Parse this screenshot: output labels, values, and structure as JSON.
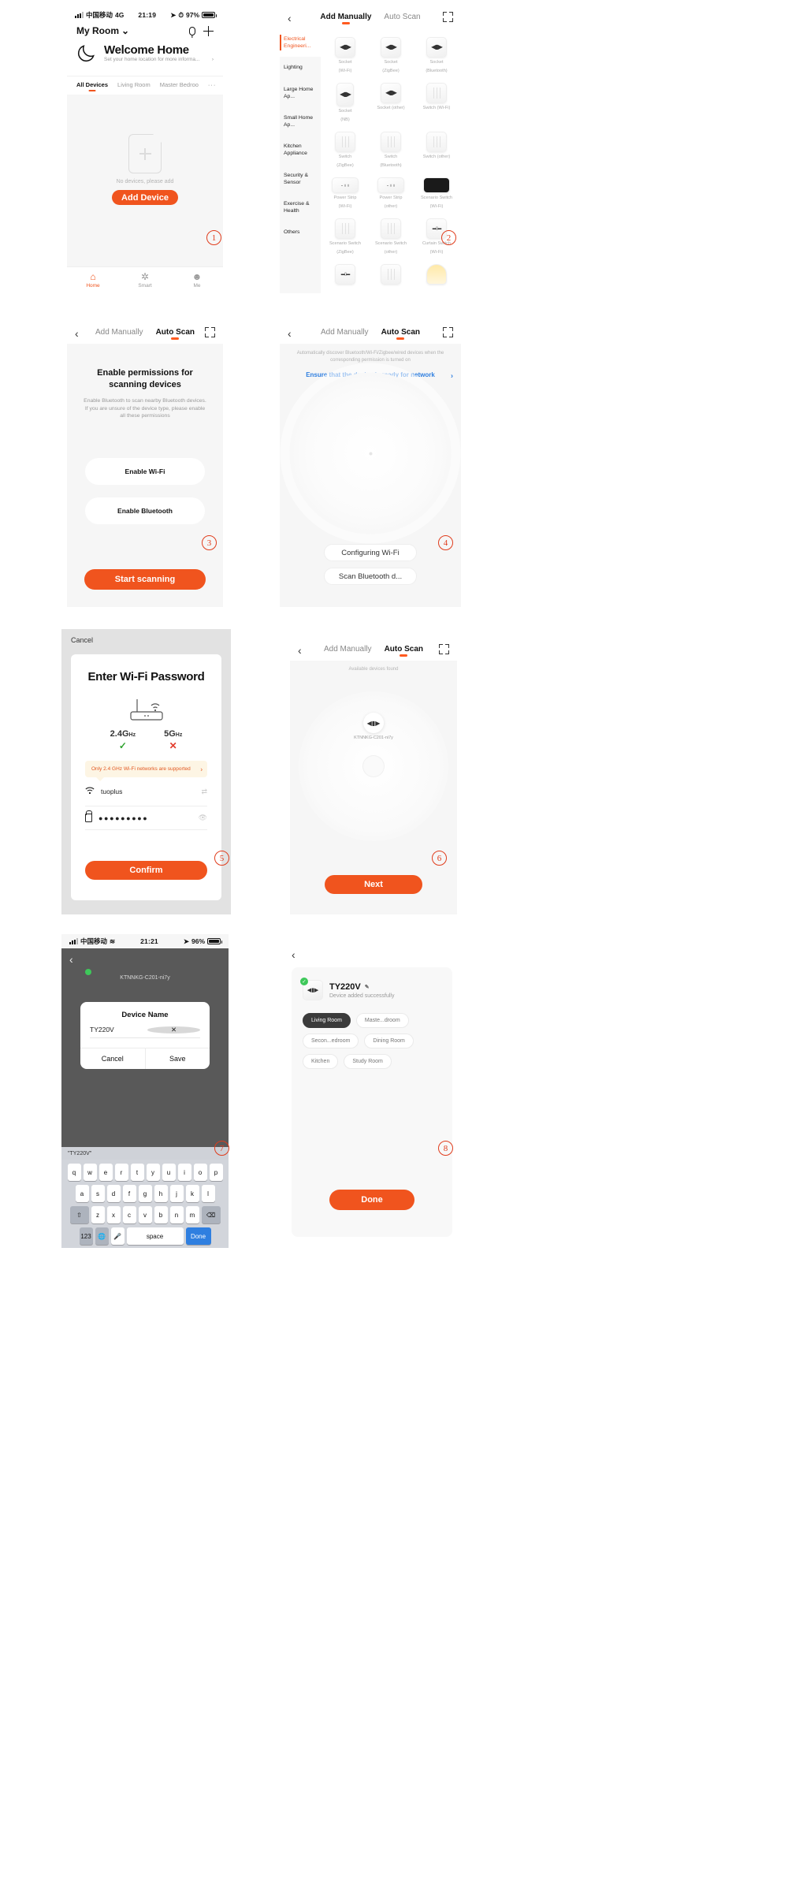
{
  "panel1": {
    "status": {
      "carrier": "中国移动",
      "network": "4G",
      "time": "21:19",
      "battery": "97%"
    },
    "room_name": "My Room",
    "icons": {
      "mic": "mic-icon",
      "add": "plus-icon",
      "chevron": "⌄"
    },
    "welcome_title": "Welcome Home",
    "welcome_sub": "Set your home location for more informa...",
    "tabs": [
      {
        "label": "All Devices",
        "active": true
      },
      {
        "label": "Living Room",
        "active": false
      },
      {
        "label": "Master Bedroo",
        "active": false
      }
    ],
    "more": "···",
    "empty_text": "No devices, please add",
    "add_device": "Add Device",
    "bottom_nav": [
      {
        "label": "Home",
        "icon": "home-icon",
        "glyph": "⌂",
        "active": true
      },
      {
        "label": "Smart",
        "icon": "smart-icon",
        "glyph": "✲",
        "active": false
      },
      {
        "label": "Me",
        "icon": "profile-icon",
        "glyph": "☻",
        "active": false
      }
    ],
    "badge": "1"
  },
  "panel2": {
    "nav": {
      "back": "‹",
      "tabs": [
        {
          "label": "Add Manually",
          "active": true
        },
        {
          "label": "Auto Scan",
          "active": false
        }
      ],
      "scan": "scan-icon"
    },
    "categories": [
      {
        "label": "Electrical Engineeri...",
        "active": true
      },
      {
        "label": "Lighting",
        "active": false
      },
      {
        "label": "Large Home Ap...",
        "active": false
      },
      {
        "label": "Small Home Ap...",
        "active": false
      },
      {
        "label": "Kitchen Appliance",
        "active": false
      },
      {
        "label": "Security & Sensor",
        "active": false
      },
      {
        "label": "Exercise & Health",
        "active": false
      },
      {
        "label": "Others",
        "active": false
      }
    ],
    "devices": [
      {
        "l1": "Socket",
        "l2": "(Wi-Fi)",
        "kind": "socket"
      },
      {
        "l1": "Socket",
        "l2": "(ZigBee)",
        "kind": "socket"
      },
      {
        "l1": "Socket",
        "l2": "(Bluetooth)",
        "kind": "socket"
      },
      {
        "l1": "Socket",
        "l2": "(NB)",
        "kind": "socket-tall"
      },
      {
        "l1": "Socket (other)",
        "l2": "",
        "kind": "socket"
      },
      {
        "l1": "Switch (Wi-Fi)",
        "l2": "",
        "kind": "switch"
      },
      {
        "l1": "Switch",
        "l2": "(ZigBee)",
        "kind": "switch"
      },
      {
        "l1": "Switch",
        "l2": "(Bluetooth)",
        "kind": "switch"
      },
      {
        "l1": "Switch (other)",
        "l2": "",
        "kind": "switch"
      },
      {
        "l1": "Power Strip",
        "l2": "(Wi-Fi)",
        "kind": "strip"
      },
      {
        "l1": "Power Strip",
        "l2": "(other)",
        "kind": "strip"
      },
      {
        "l1": "Scenario Switch",
        "l2": "(Wi-Fi)",
        "kind": "black"
      },
      {
        "l1": "Scenario Switch",
        "l2": "(ZigBee)",
        "kind": "plain"
      },
      {
        "l1": "Scenario Switch",
        "l2": "(other)",
        "kind": "plain"
      },
      {
        "l1": "Curtain Switch",
        "l2": "(Wi-Fi)",
        "kind": "curtain"
      },
      {
        "l1": "",
        "l2": "",
        "kind": "curtain"
      },
      {
        "l1": "",
        "l2": "",
        "kind": "switch"
      },
      {
        "l1": "",
        "l2": "",
        "kind": "lamp"
      }
    ],
    "badge": "2"
  },
  "panel3": {
    "nav": {
      "back": "‹",
      "tabs": [
        {
          "label": "Add Manually",
          "active": false
        },
        {
          "label": "Auto Scan",
          "active": true
        }
      ],
      "scan": "scan-icon"
    },
    "title": "Enable permissions for scanning devices",
    "subtitle": "Enable Bluetooth to scan nearby Bluetooth devices. If you are unsure of the device type, please enable all these permissions",
    "buttons": [
      "Enable Wi-Fi",
      "Enable Bluetooth"
    ],
    "cta": "Start scanning",
    "badge": "3"
  },
  "panel4": {
    "nav": {
      "back": "‹",
      "tabs": [
        {
          "label": "Add Manually",
          "active": false
        },
        {
          "label": "Auto Scan",
          "active": true
        }
      ],
      "scan": "scan-icon"
    },
    "note": "Automatically discover Bluetooth/Wi-Fi/Zigbee/wired devices when the corresponding permission is turned on",
    "link": "Ensure that the device is ready for network connection.",
    "link_chevron": "›",
    "buttons": [
      "Configuring Wi-Fi",
      "Scan Bluetooth d..."
    ],
    "badge": "4"
  },
  "panel5": {
    "cancel": "Cancel",
    "title": "Enter Wi-Fi Password",
    "freq": [
      {
        "label": "2.4G",
        "unit": "Hz",
        "mark": "✓",
        "ok": true
      },
      {
        "label": "5G",
        "unit": "Hz",
        "mark": "✕",
        "ok": false
      }
    ],
    "tip": "Only 2.4 GHz Wi-Fi networks are supported",
    "tip_chevron": "›",
    "ssid": "tuoplus",
    "password": "●●●●●●●●●",
    "confirm": "Confirm",
    "badge": "5"
  },
  "panel6": {
    "nav": {
      "back": "‹",
      "tabs": [
        {
          "label": "Add Manually",
          "active": false
        },
        {
          "label": "Auto Scan",
          "active": true
        }
      ],
      "scan": "scan-icon"
    },
    "found_label": "Available devices found",
    "device_name": "KTNNKG-C201-ni7y",
    "next": "Next",
    "badge": "6"
  },
  "panel7": {
    "status": {
      "carrier": "中国移动",
      "time": "21:21",
      "battery": "96%"
    },
    "ghost_device": "KTNNKG-C201-ni7y",
    "dialog": {
      "title": "Device Name",
      "value": "TY220V",
      "cancel": "Cancel",
      "save": "Save"
    },
    "suggestion": "\"TY220V\"",
    "keyboard": {
      "row1": [
        "q",
        "w",
        "e",
        "r",
        "t",
        "y",
        "u",
        "i",
        "o",
        "p"
      ],
      "row2": [
        "a",
        "s",
        "d",
        "f",
        "g",
        "h",
        "j",
        "k",
        "l"
      ],
      "row3": [
        "⇧",
        "z",
        "x",
        "c",
        "v",
        "b",
        "n",
        "m",
        "⌫"
      ],
      "row4": [
        "123",
        "🌐",
        "🎤",
        "space",
        "Done"
      ]
    },
    "badge": "7"
  },
  "panel8": {
    "nav": {
      "back": "‹"
    },
    "device_name": "TY220V",
    "pencil": "✎",
    "success": "Device added successfully",
    "check": "✓",
    "rooms": [
      {
        "label": "Living Room",
        "selected": true
      },
      {
        "label": "Maste...droom",
        "selected": false
      },
      {
        "label": "Secon...edroom",
        "selected": false
      },
      {
        "label": "Dining Room",
        "selected": false
      },
      {
        "label": "Kitchen",
        "selected": false
      },
      {
        "label": "Study Room",
        "selected": false
      }
    ],
    "done": "Done",
    "badge": "8"
  }
}
